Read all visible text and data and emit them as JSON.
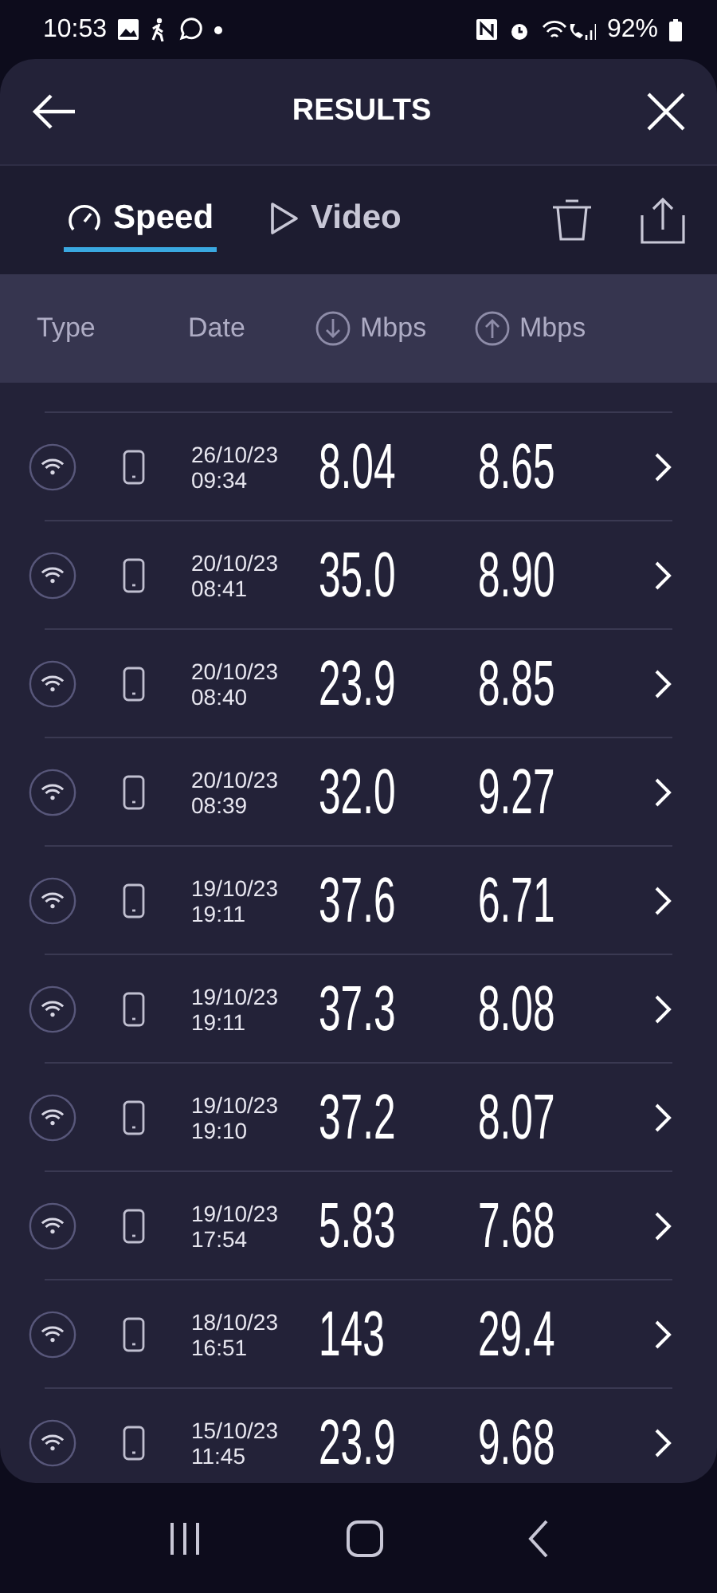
{
  "status_bar": {
    "time": "10:53",
    "battery": "92%"
  },
  "header": {
    "title": "RESULTS"
  },
  "tabs": [
    {
      "label": "Speed",
      "kind": "speed",
      "selected": true
    },
    {
      "label": "Video",
      "kind": "video",
      "selected": false
    }
  ],
  "columns": [
    {
      "label": "Type",
      "kind": "plain"
    },
    {
      "label": "Date",
      "kind": "plain"
    },
    {
      "label": "Mbps",
      "kind": "download"
    },
    {
      "label": "Mbps",
      "kind": "upload"
    }
  ],
  "rows": [
    {
      "date": "26/10/23",
      "time": "09:34",
      "download": "8.04",
      "upload": "8.65"
    },
    {
      "date": "20/10/23",
      "time": "08:41",
      "download": "35.0",
      "upload": "8.90"
    },
    {
      "date": "20/10/23",
      "time": "08:40",
      "download": "23.9",
      "upload": "8.85"
    },
    {
      "date": "20/10/23",
      "time": "08:39",
      "download": "32.0",
      "upload": "9.27"
    },
    {
      "date": "19/10/23",
      "time": "19:11",
      "download": "37.6",
      "upload": "6.71"
    },
    {
      "date": "19/10/23",
      "time": "19:11",
      "download": "37.3",
      "upload": "8.08"
    },
    {
      "date": "19/10/23",
      "time": "19:10",
      "download": "37.2",
      "upload": "8.07"
    },
    {
      "date": "19/10/23",
      "time": "17:54",
      "download": "5.83",
      "upload": "7.68"
    },
    {
      "date": "18/10/23",
      "time": "16:51",
      "download": "143",
      "upload": "29.4"
    },
    {
      "date": "15/10/23",
      "time": "11:45",
      "download": "23.9",
      "upload": "9.68"
    }
  ]
}
